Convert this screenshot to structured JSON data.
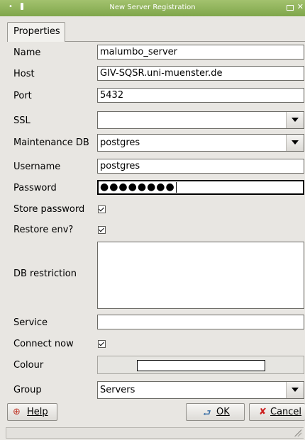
{
  "window": {
    "title": "New Server Registration"
  },
  "tabs": [
    {
      "label": "Properties"
    }
  ],
  "form": {
    "name": {
      "label": "Name",
      "value": "malumbo_server"
    },
    "host": {
      "label": "Host",
      "value": "GIV-SQSR.uni-muenster.de"
    },
    "port": {
      "label": "Port",
      "value": "5432"
    },
    "ssl": {
      "label": "SSL",
      "value": ""
    },
    "maintenance_db": {
      "label": "Maintenance DB",
      "value": "postgres"
    },
    "username": {
      "label": "Username",
      "value": "postgres"
    },
    "password": {
      "label": "Password",
      "value": "●●●●●●●●"
    },
    "store_password": {
      "label": "Store password",
      "checked": true
    },
    "restore_env": {
      "label": "Restore env?",
      "checked": true
    },
    "db_restriction": {
      "label": "DB restriction",
      "value": ""
    },
    "service": {
      "label": "Service",
      "value": ""
    },
    "connect_now": {
      "label": "Connect now",
      "checked": true
    },
    "colour": {
      "label": "Colour",
      "value": "#ffffff"
    },
    "group": {
      "label": "Group",
      "value": "Servers"
    }
  },
  "buttons": {
    "help": "Help",
    "ok": "OK",
    "cancel": "Cancel"
  },
  "icons": {
    "help": "lifebuoy-icon",
    "ok": "ok-arrow-icon",
    "cancel": "cancel-x-icon"
  }
}
